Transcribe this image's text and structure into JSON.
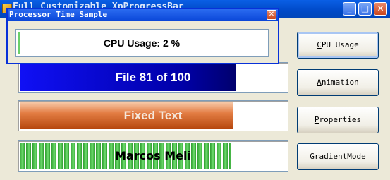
{
  "main_window": {
    "title": "Full Customizable XpProgressBar",
    "controls": {
      "minimize": "_",
      "maximize": "□",
      "close": "✕"
    }
  },
  "bars": {
    "file": {
      "text": "File 81 of 100",
      "progress": 0.81
    },
    "fixed": {
      "text": "Fixed Text",
      "progress": 0.8
    },
    "blocks": {
      "text": "Marcos Meli",
      "progress": 0.79
    }
  },
  "buttons": {
    "cpu_usage": {
      "accel": "C",
      "rest": "PU Usage"
    },
    "animation": {
      "accel": "A",
      "rest": "nimation"
    },
    "properties": {
      "accel": "P",
      "rest": "roperties"
    },
    "gradient_mode": {
      "accel": "G",
      "rest": "radientMode"
    }
  },
  "dialog": {
    "title": "Processor Time Sample",
    "close": "✕",
    "cpu_text": "CPU Usage: 2 %",
    "cpu_progress": 0.02
  },
  "colors": {
    "titlebar_blue": "#0A5FE5",
    "file_bar": "#0000A8",
    "fixed_bar": "#E37D43",
    "blocks_bar": "#2F9E2F"
  }
}
